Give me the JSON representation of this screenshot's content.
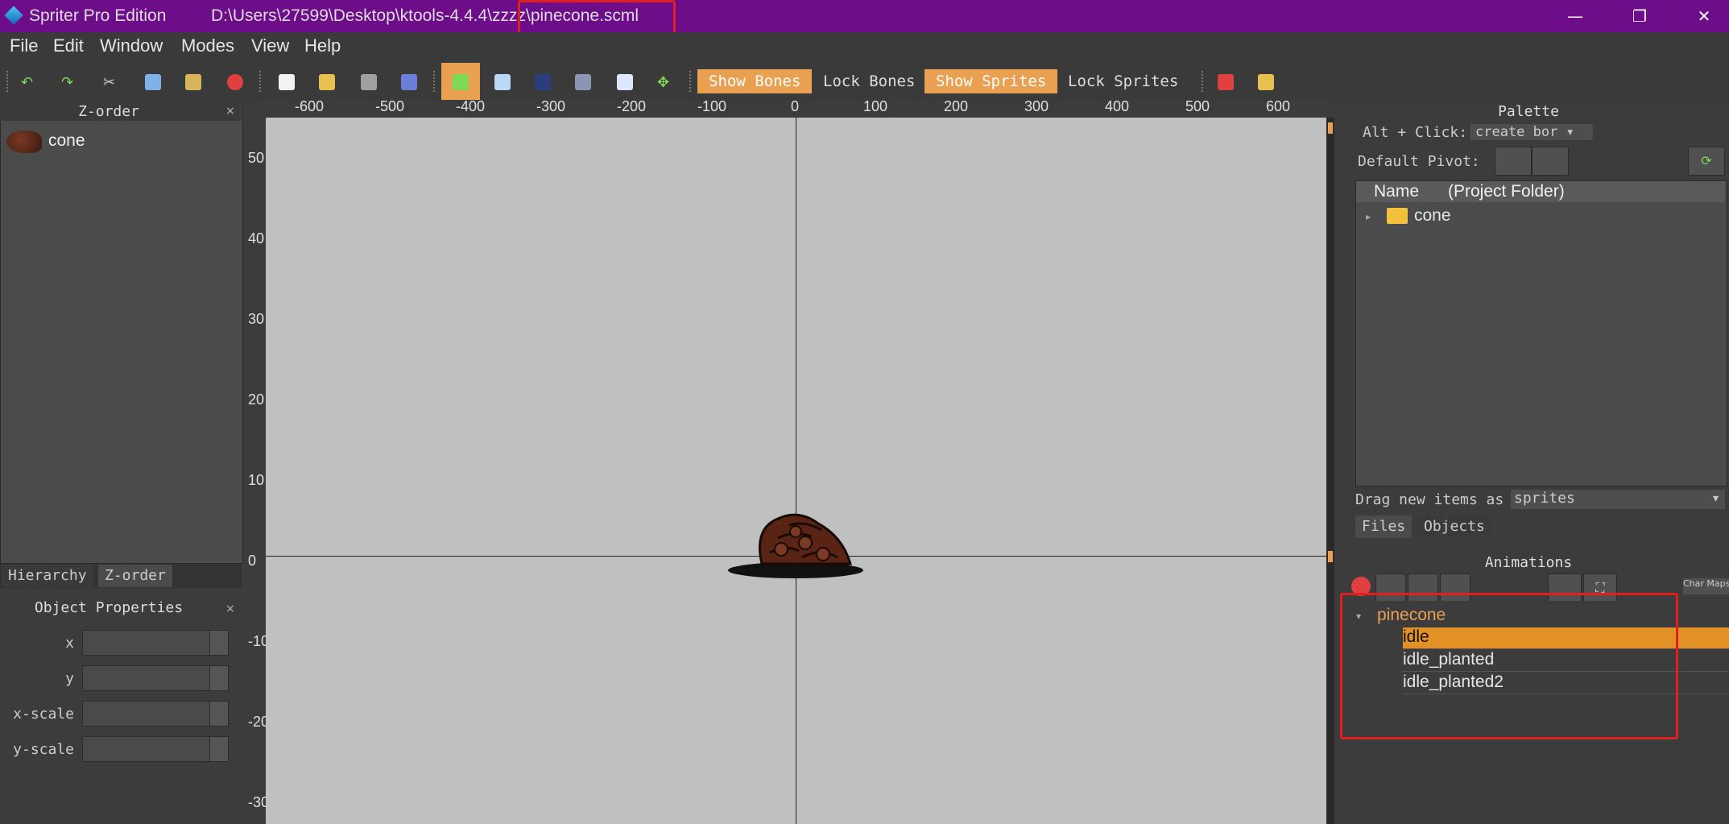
{
  "titlebar": {
    "app_title": "Spriter Pro Edition",
    "file_path": "D:\\Users\\27599\\Desktop\\ktools-4.4.4\\zzzz\\pinecone.scml",
    "minimize": "—",
    "restore": "❐",
    "close": "✕"
  },
  "menu": [
    "File",
    "Edit",
    "Window",
    "Modes",
    "View",
    "Help"
  ],
  "toolbar": {
    "show_bones": "Show Bones",
    "lock_bones": "Lock Bones",
    "show_sprites": "Show Sprites",
    "lock_sprites": "Lock Sprites"
  },
  "zorder": {
    "title": "Z-order",
    "close": "×",
    "items": [
      {
        "label": "cone"
      }
    ],
    "tabs": [
      "Hierarchy",
      "Z-order"
    ]
  },
  "ruler_top": [
    "-600",
    "-500",
    "-400",
    "-300",
    "-200",
    "-100",
    "0",
    "100",
    "200",
    "300",
    "400",
    "500",
    "600"
  ],
  "ruler_left": [
    "50",
    "40",
    "30",
    "20",
    "10",
    "0",
    "-10",
    "-20",
    "-30"
  ],
  "object_properties": {
    "title": "Object Properties",
    "close": "×",
    "fields": [
      "x",
      "y",
      "x-scale",
      "y-scale"
    ]
  },
  "palette": {
    "title": "Palette",
    "alt_click_label": "Alt + Click:",
    "alt_click_value": "create bor",
    "default_pivot_label": "Default Pivot:",
    "tree_header_name": "Name",
    "tree_header_folder": "(Project Folder)",
    "tree_items": [
      "cone"
    ],
    "drag_label": "Drag new items as",
    "drag_value": "sprites",
    "tabs": [
      "Files",
      "Objects"
    ]
  },
  "animations": {
    "title": "Animations",
    "char_maps": "Char Maps",
    "entity": "pinecone",
    "list": [
      "idle",
      "idle_planted",
      "idle_planted2"
    ],
    "selected": "idle"
  },
  "colors": {
    "titlebar": "#6d0d8a",
    "accent": "#e9a050",
    "selected": "#e39024",
    "canvas": "#c0c0c0"
  }
}
